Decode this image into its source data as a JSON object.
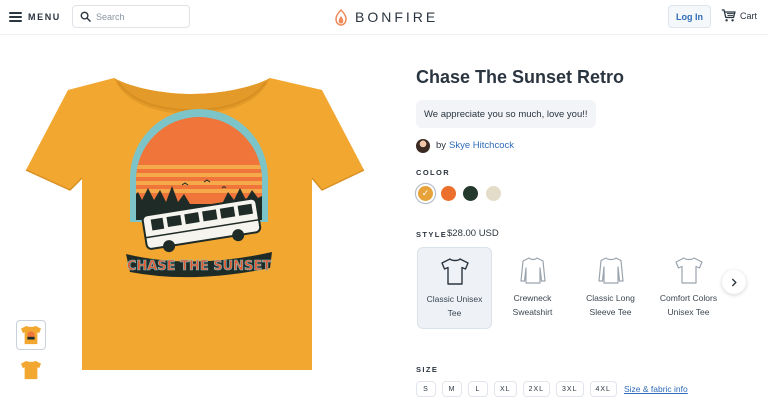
{
  "header": {
    "menu_label": "MENU",
    "search_placeholder": "Search",
    "logo_text": "BONFIRE",
    "login_label": "Log In",
    "cart_label": "Cart"
  },
  "product": {
    "title": "Chase The Sunset Retro",
    "message": "We appreciate you so much, love you!!",
    "by_prefix": "by",
    "author": "Skye Hitchcock",
    "shirt_graphic_text": "CHASE THE SUNSET"
  },
  "color": {
    "label": "COLOR",
    "swatches": [
      {
        "name": "gold",
        "hex": "#e8a23a",
        "selected": true
      },
      {
        "name": "orange",
        "hex": "#ec6f2e",
        "selected": false
      },
      {
        "name": "forest-green",
        "hex": "#243a2c",
        "selected": false
      },
      {
        "name": "natural",
        "hex": "#e3dcc8",
        "selected": false
      }
    ]
  },
  "style": {
    "label": "STYLE",
    "price": "$28.00 USD",
    "options": [
      {
        "name": "Classic Unisex Tee",
        "selected": true
      },
      {
        "name": "Crewneck Sweatshirt",
        "selected": false
      },
      {
        "name": "Classic Long Sleeve Tee",
        "selected": false
      },
      {
        "name": "Comfort Colors Unisex Tee",
        "selected": false
      }
    ]
  },
  "size": {
    "label": "SIZE",
    "options": [
      "S",
      "M",
      "L",
      "XL",
      "2XL",
      "3XL",
      "4XL"
    ],
    "guide_link": "Size & fabric info"
  },
  "colors": {
    "accent_blue": "#2e6bb8",
    "text_dark": "#2b3540",
    "shirt_gold": "#f2a731",
    "logo_orange": "#ef8a5a"
  },
  "icons": [
    "menu-icon",
    "search-icon",
    "flame-logo-icon",
    "cart-icon",
    "check-icon",
    "tshirt-icon",
    "sweatshirt-icon",
    "long-sleeve-icon",
    "chevron-right-icon"
  ]
}
